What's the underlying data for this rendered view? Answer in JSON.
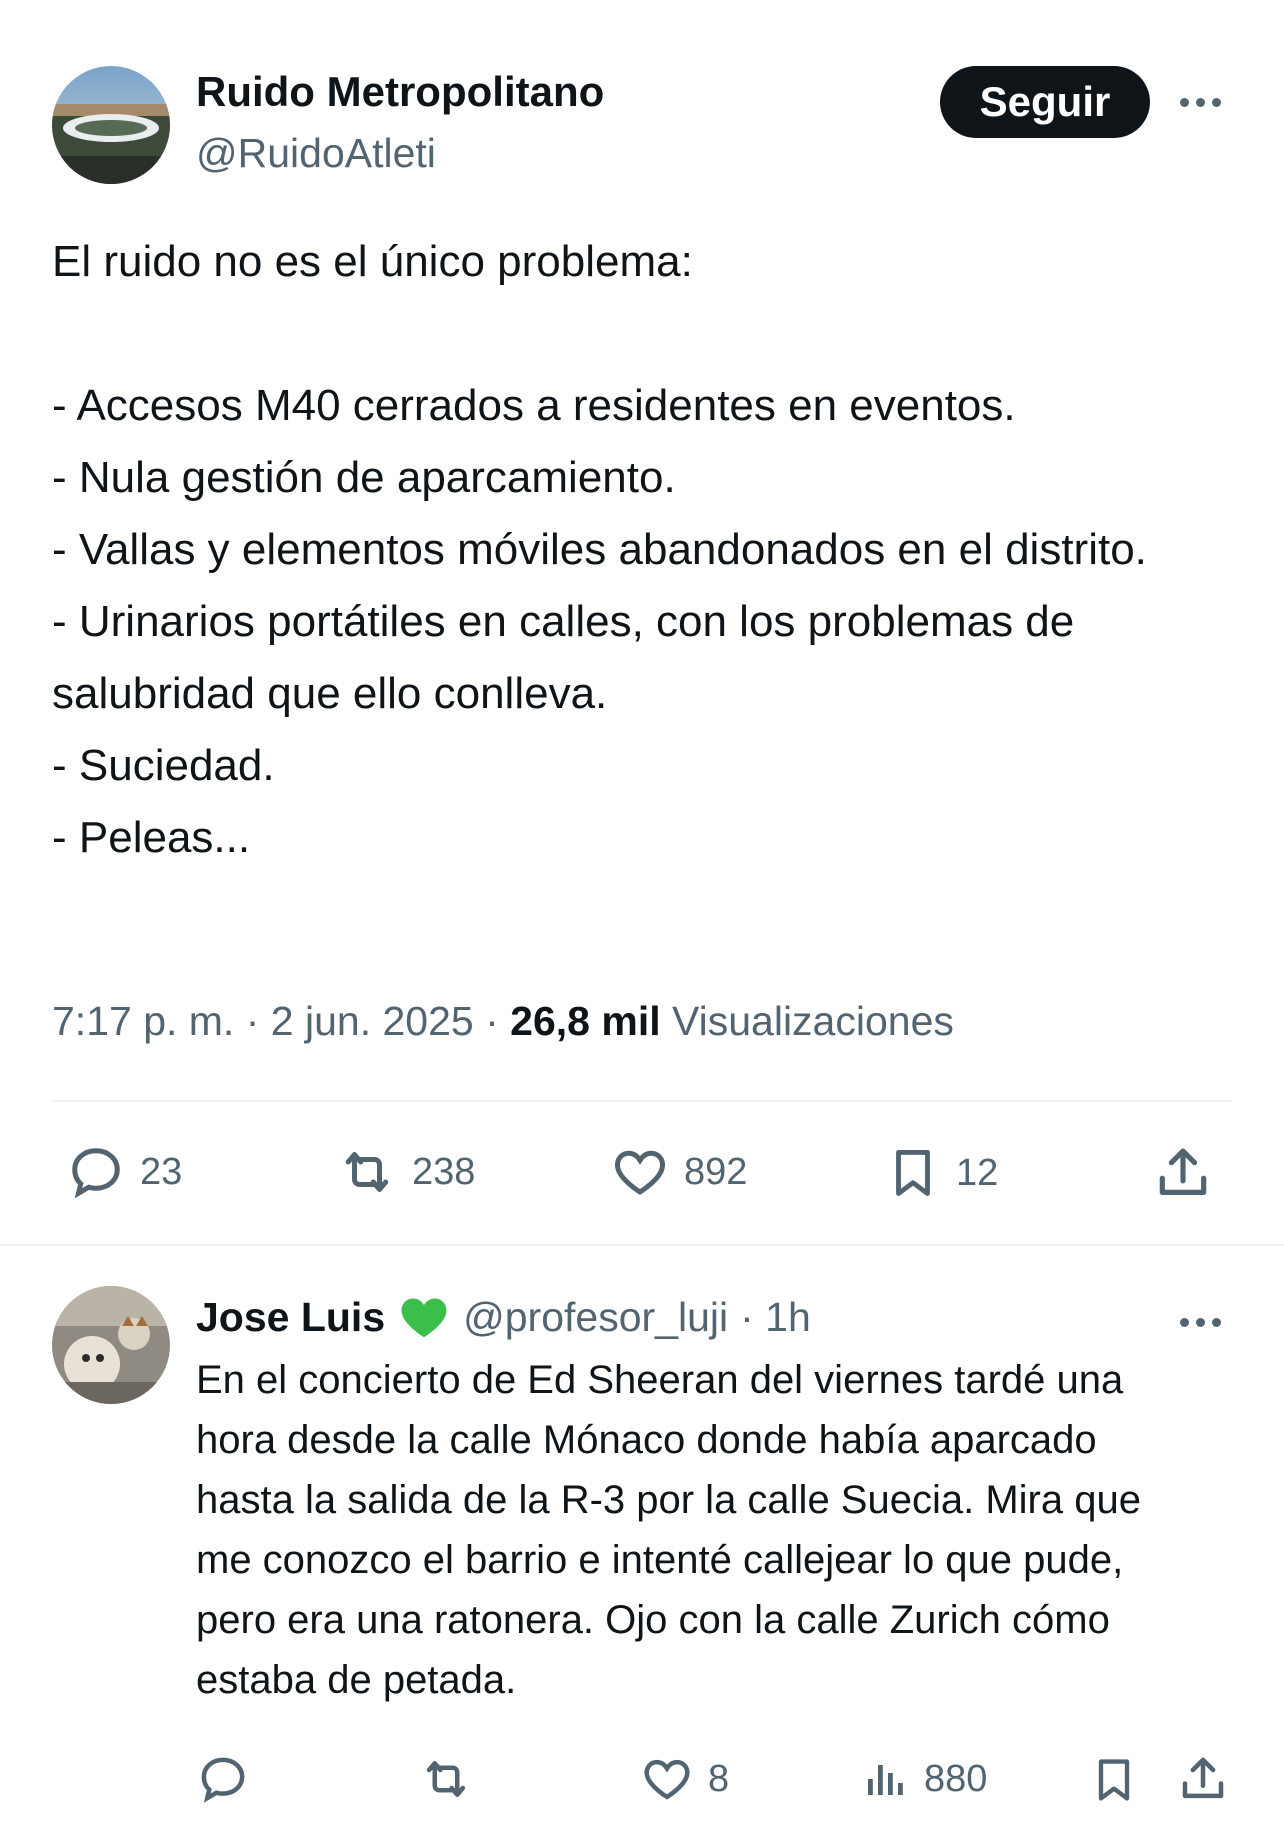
{
  "main_tweet": {
    "author_name": "Ruido Metropolitano",
    "author_handle": "@RuidoAtleti",
    "follow_label": "Seguir",
    "text": "El ruido no es el único problema:\n\n- Accesos M40 cerrados a residentes en eventos.\n- Nula gestión de aparcamiento.\n- Vallas y elementos móviles abandonados en el distrito.\n- Urinarios portátiles en calles, con los problemas de salubridad que ello conlleva.\n- Suciedad.\n- Peleas...",
    "time": "7:17 p. m.",
    "separator": "·",
    "date": "2 jun. 2025",
    "views_count": "26,8 mil",
    "views_label": "Visualizaciones",
    "actions": {
      "replies": "23",
      "retweets": "238",
      "likes": "892",
      "bookmarks": "12"
    }
  },
  "reply": {
    "author_name": "Jose Luis",
    "badge": "💚",
    "author_handle": "@profesor_luji",
    "time_ago": "· 1h",
    "text": "En el concierto de Ed Sheeran del viernes tardé una hora desde la calle Mónaco donde había aparcado hasta la salida de la R-3 por la calle Suecia. Mira que me conozco el barrio e intenté callejear lo que pude, pero era una ratonera. Ojo con la calle Zurich cómo estaba de petada.",
    "actions": {
      "likes": "8",
      "views": "880"
    }
  },
  "colors": {
    "text": "#0f1419",
    "muted": "#536471",
    "divider": "#eff3f4",
    "heart_badge": "#3cbf4a"
  }
}
